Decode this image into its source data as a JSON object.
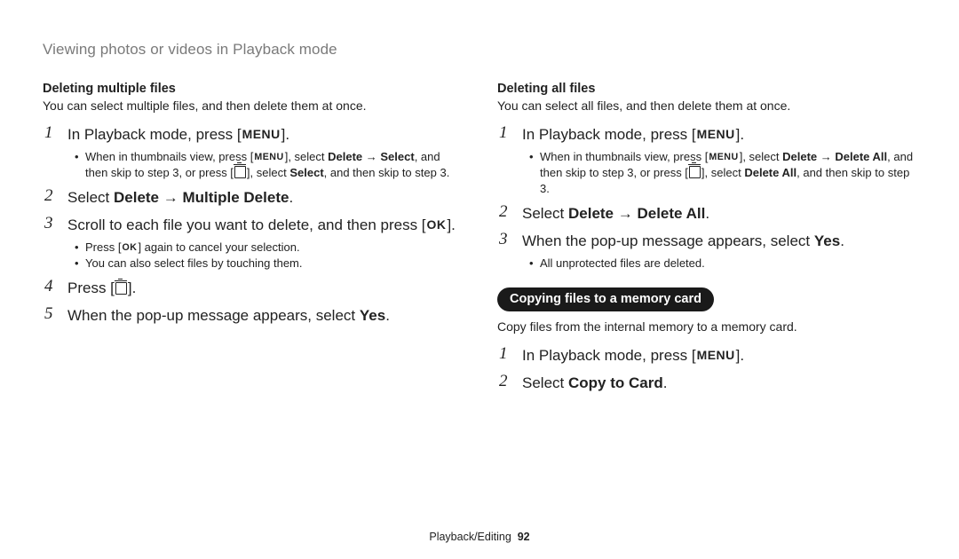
{
  "header": "Viewing photos or videos in Playback mode",
  "left": {
    "subhead": "Deleting multiple files",
    "desc": "You can select multiple files, and then delete them at once.",
    "steps": [
      {
        "main_pre": "In Playback mode, press [",
        "main_btn": "MENU",
        "main_post": "].",
        "subs": [
          {
            "a": "When in thumbnails view, press [",
            "btn": "MENU",
            "b": "], select ",
            "strong1": "Delete",
            "c": " → ",
            "strong2": "Select",
            "d": ", and then skip to step 3, or press [",
            "trash": true,
            "e": "], select ",
            "strong3": "Select",
            "f": ", and then skip to step 3."
          }
        ]
      },
      {
        "main_pre": "Select ",
        "strong1": "Delete",
        "arrow": " → ",
        "strong2": "Multiple Delete",
        "main_post": "."
      },
      {
        "main_pre": "Scroll to each file you want to delete, and then press [",
        "main_btn": "OK",
        "main_post": "].",
        "subs": [
          {
            "a": "Press [",
            "btn": "OK",
            "b": "] again to cancel your selection."
          },
          {
            "a": "You can also select files by touching them."
          }
        ]
      },
      {
        "main_pre": "Press [",
        "trash": true,
        "main_post": "]."
      },
      {
        "main_pre": "When the pop-up message appears, select ",
        "strong1": "Yes",
        "main_post": "."
      }
    ]
  },
  "right": {
    "subhead": "Deleting all files",
    "desc": "You can select all files, and then delete them at once.",
    "steps": [
      {
        "main_pre": "In Playback mode, press [",
        "main_btn": "MENU",
        "main_post": "].",
        "subs": [
          {
            "a": "When in thumbnails view, press [",
            "btn": "MENU",
            "b": "], select ",
            "strong1": "Delete",
            "c": " → ",
            "strong2": "Delete All",
            "d": ", and then skip to step 3, or press [",
            "trash": true,
            "e": "], select ",
            "strong3": "Delete All",
            "f": ", and then skip to step 3."
          }
        ]
      },
      {
        "main_pre": "Select ",
        "strong1": "Delete",
        "arrow": " → ",
        "strong2": "Delete All",
        "main_post": "."
      },
      {
        "main_pre": "When the pop-up message appears, select ",
        "strong1": "Yes",
        "main_post": ".",
        "subs": [
          {
            "a": "All unprotected files are deleted."
          }
        ]
      }
    ],
    "pill": "Copying files to a memory card",
    "desc2": "Copy files from the internal memory to a memory card.",
    "steps2": [
      {
        "main_pre": "In Playback mode, press [",
        "main_btn": "MENU",
        "main_post": "]."
      },
      {
        "main_pre": "Select ",
        "strong1": "Copy to Card",
        "main_post": "."
      }
    ]
  },
  "footer_section": "Playback/Editing",
  "footer_page": "92"
}
